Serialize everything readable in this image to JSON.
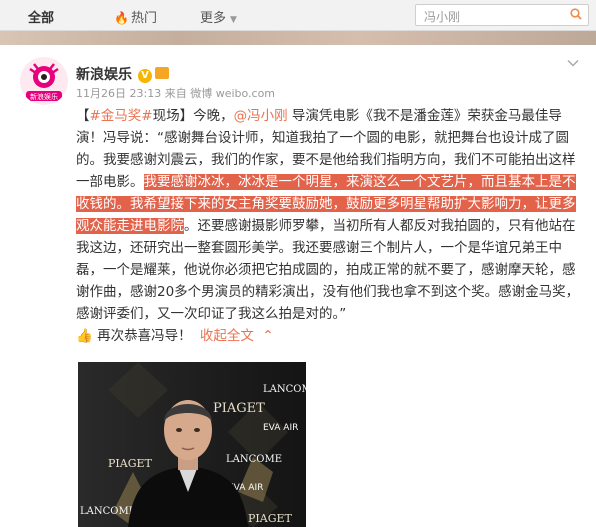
{
  "topbar": {
    "tabs": [
      {
        "label": "全部"
      },
      {
        "label": "热门"
      },
      {
        "label": "更多"
      }
    ],
    "search_value": "冯小刚"
  },
  "post": {
    "author": "新浪娱乐",
    "avatar_text": "新浪娱乐",
    "time": "11月26日 23:13",
    "source": "来自 微博 weibo.com",
    "body": {
      "tag": "#金马奖#",
      "tag2": "现场",
      "t1": "】今晚，",
      "mention": "@冯小刚",
      "t2": " 导演凭电影《我不是潘金莲》荣获金马最佳导演！冯导说：“感谢舞台设计师，知道我拍了一个圆的电影，就把舞台也设计成了圆的。我要感谢刘震云，我们的作家，要不是他给我们指明方向，我们不可能拍出这样一部电影。",
      "highlight": "我要感谢冰冰，冰冰是一个明星，来演这么一个文艺片，而且基本上是不收钱的。我希望接下来的女主角奖要鼓励她，鼓励更多明星帮助扩大影响力，让更多观众能走进电影院",
      "t3": "。还要感谢摄影师罗攀，当初所有人都反对我拍圆的，只有他站在我这边，还研究出一整套圆形美学。我还要感谢三个制片人，一个是华谊兄弟王中磊，一个是耀莱，他说你必须把它拍成圆的，拍成正常的就不要了，感谢摩天轮，感谢作曲，感谢20多个男演员的精彩演出，没有他们我也拿不到这个奖。感谢金马奖，感谢评委们，又一次印证了我这么拍是对的。”",
      "closing": "再次恭喜冯导！",
      "collapse_label": "收起全文"
    }
  },
  "photo": {
    "brands": [
      "PIAGET",
      "LANCOME",
      "EVA AIR",
      "PIAGET",
      "LANCOME",
      "EVA AIR",
      "LANCOME",
      "PIAGET"
    ]
  },
  "colors": {
    "accent": "#eb7350",
    "highlight_bg": "#e3624a"
  }
}
